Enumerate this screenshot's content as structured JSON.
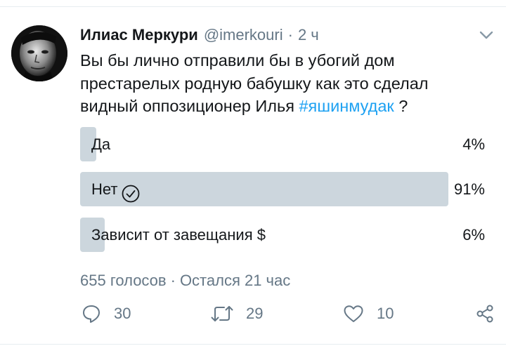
{
  "tweet": {
    "author": {
      "display_name": "Илиас Меркури",
      "handle": "@imerkouri",
      "separator": "·",
      "time": "2 ч"
    },
    "text_plain": "Вы бы лично отправили бы в убогий дом престарелых родную бабушку как это сделал видный оппозиционер Илья ",
    "hashtag": "#яшинмудак",
    "text_tail": " ?"
  },
  "poll": {
    "options": [
      {
        "label": "Да",
        "percent_text": "4%",
        "percent": 4,
        "selected": false
      },
      {
        "label": "Нет",
        "percent_text": "91%",
        "percent": 91,
        "selected": true
      },
      {
        "label": "Зависит от завещания $",
        "percent_text": "6%",
        "percent": 6,
        "selected": false
      }
    ],
    "votes": "655 голосов",
    "separator": "·",
    "remaining": "Остался 21 час"
  },
  "actions": {
    "reply_count": "30",
    "retweet_count": "29",
    "like_count": "10"
  },
  "icons": {
    "menu": "chevron-down-icon",
    "selected": "check-circle-icon",
    "reply": "reply-icon",
    "retweet": "retweet-icon",
    "like": "heart-icon",
    "share": "share-icon"
  },
  "colors": {
    "text": "#14171a",
    "secondary": "#657786",
    "link": "#1da1f2",
    "poll_bar": "#ccd6dd",
    "divider": "#e6ecf0"
  }
}
